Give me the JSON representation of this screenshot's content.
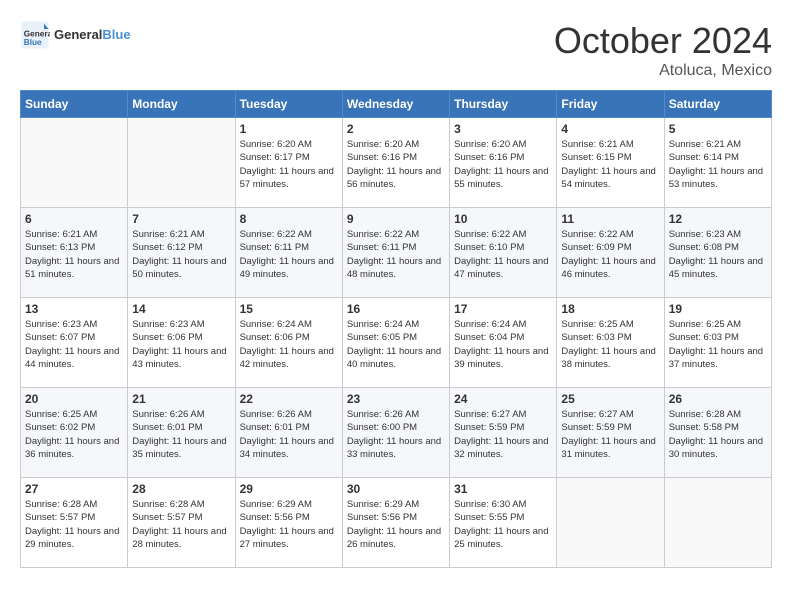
{
  "header": {
    "logo_general": "General",
    "logo_blue": "Blue",
    "month": "October 2024",
    "location": "Atoluca, Mexico"
  },
  "weekdays": [
    "Sunday",
    "Monday",
    "Tuesday",
    "Wednesday",
    "Thursday",
    "Friday",
    "Saturday"
  ],
  "weeks": [
    [
      {
        "day": "",
        "info": ""
      },
      {
        "day": "",
        "info": ""
      },
      {
        "day": "1",
        "info": "Sunrise: 6:20 AM\nSunset: 6:17 PM\nDaylight: 11 hours and 57 minutes."
      },
      {
        "day": "2",
        "info": "Sunrise: 6:20 AM\nSunset: 6:16 PM\nDaylight: 11 hours and 56 minutes."
      },
      {
        "day": "3",
        "info": "Sunrise: 6:20 AM\nSunset: 6:16 PM\nDaylight: 11 hours and 55 minutes."
      },
      {
        "day": "4",
        "info": "Sunrise: 6:21 AM\nSunset: 6:15 PM\nDaylight: 11 hours and 54 minutes."
      },
      {
        "day": "5",
        "info": "Sunrise: 6:21 AM\nSunset: 6:14 PM\nDaylight: 11 hours and 53 minutes."
      }
    ],
    [
      {
        "day": "6",
        "info": "Sunrise: 6:21 AM\nSunset: 6:13 PM\nDaylight: 11 hours and 51 minutes."
      },
      {
        "day": "7",
        "info": "Sunrise: 6:21 AM\nSunset: 6:12 PM\nDaylight: 11 hours and 50 minutes."
      },
      {
        "day": "8",
        "info": "Sunrise: 6:22 AM\nSunset: 6:11 PM\nDaylight: 11 hours and 49 minutes."
      },
      {
        "day": "9",
        "info": "Sunrise: 6:22 AM\nSunset: 6:11 PM\nDaylight: 11 hours and 48 minutes."
      },
      {
        "day": "10",
        "info": "Sunrise: 6:22 AM\nSunset: 6:10 PM\nDaylight: 11 hours and 47 minutes."
      },
      {
        "day": "11",
        "info": "Sunrise: 6:22 AM\nSunset: 6:09 PM\nDaylight: 11 hours and 46 minutes."
      },
      {
        "day": "12",
        "info": "Sunrise: 6:23 AM\nSunset: 6:08 PM\nDaylight: 11 hours and 45 minutes."
      }
    ],
    [
      {
        "day": "13",
        "info": "Sunrise: 6:23 AM\nSunset: 6:07 PM\nDaylight: 11 hours and 44 minutes."
      },
      {
        "day": "14",
        "info": "Sunrise: 6:23 AM\nSunset: 6:06 PM\nDaylight: 11 hours and 43 minutes."
      },
      {
        "day": "15",
        "info": "Sunrise: 6:24 AM\nSunset: 6:06 PM\nDaylight: 11 hours and 42 minutes."
      },
      {
        "day": "16",
        "info": "Sunrise: 6:24 AM\nSunset: 6:05 PM\nDaylight: 11 hours and 40 minutes."
      },
      {
        "day": "17",
        "info": "Sunrise: 6:24 AM\nSunset: 6:04 PM\nDaylight: 11 hours and 39 minutes."
      },
      {
        "day": "18",
        "info": "Sunrise: 6:25 AM\nSunset: 6:03 PM\nDaylight: 11 hours and 38 minutes."
      },
      {
        "day": "19",
        "info": "Sunrise: 6:25 AM\nSunset: 6:03 PM\nDaylight: 11 hours and 37 minutes."
      }
    ],
    [
      {
        "day": "20",
        "info": "Sunrise: 6:25 AM\nSunset: 6:02 PM\nDaylight: 11 hours and 36 minutes."
      },
      {
        "day": "21",
        "info": "Sunrise: 6:26 AM\nSunset: 6:01 PM\nDaylight: 11 hours and 35 minutes."
      },
      {
        "day": "22",
        "info": "Sunrise: 6:26 AM\nSunset: 6:01 PM\nDaylight: 11 hours and 34 minutes."
      },
      {
        "day": "23",
        "info": "Sunrise: 6:26 AM\nSunset: 6:00 PM\nDaylight: 11 hours and 33 minutes."
      },
      {
        "day": "24",
        "info": "Sunrise: 6:27 AM\nSunset: 5:59 PM\nDaylight: 11 hours and 32 minutes."
      },
      {
        "day": "25",
        "info": "Sunrise: 6:27 AM\nSunset: 5:59 PM\nDaylight: 11 hours and 31 minutes."
      },
      {
        "day": "26",
        "info": "Sunrise: 6:28 AM\nSunset: 5:58 PM\nDaylight: 11 hours and 30 minutes."
      }
    ],
    [
      {
        "day": "27",
        "info": "Sunrise: 6:28 AM\nSunset: 5:57 PM\nDaylight: 11 hours and 29 minutes."
      },
      {
        "day": "28",
        "info": "Sunrise: 6:28 AM\nSunset: 5:57 PM\nDaylight: 11 hours and 28 minutes."
      },
      {
        "day": "29",
        "info": "Sunrise: 6:29 AM\nSunset: 5:56 PM\nDaylight: 11 hours and 27 minutes."
      },
      {
        "day": "30",
        "info": "Sunrise: 6:29 AM\nSunset: 5:56 PM\nDaylight: 11 hours and 26 minutes."
      },
      {
        "day": "31",
        "info": "Sunrise: 6:30 AM\nSunset: 5:55 PM\nDaylight: 11 hours and 25 minutes."
      },
      {
        "day": "",
        "info": ""
      },
      {
        "day": "",
        "info": ""
      }
    ]
  ]
}
